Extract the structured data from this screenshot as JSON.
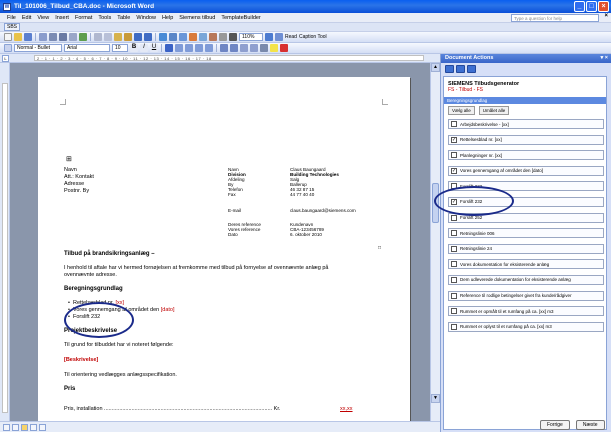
{
  "window": {
    "title": "Til_101006_Tilbud_CBA.doc - Microsoft Word"
  },
  "menu": {
    "items": [
      "File",
      "Edit",
      "View",
      "Insert",
      "Format",
      "Tools",
      "Table",
      "Window",
      "Help",
      "Siemens tilbud",
      "TemplateBuilder"
    ],
    "help_placeholder": "Type a question for help",
    "sbs": "SBS"
  },
  "toolbar": {
    "style": "Normal - Bullet",
    "font": "Arial",
    "size": "10",
    "zoom": "110%",
    "read": "Read",
    "caption": "Caption Tool"
  },
  "ruler": {
    "text": "2 · 1 · 1 · 2 · 3 · 4 · 5 · 6 · 7 · 8 · 9 · 10 · 11 · 12 · 13 · 14 · 15 · 16 · 17 · 18"
  },
  "document": {
    "left_block": [
      "Navn",
      "Att.: Kontakt",
      "Adresse",
      "Postnr. By"
    ],
    "right_labels": [
      "Navn",
      "Division",
      "Afdeling",
      "By",
      "Telefon",
      "Fax",
      "",
      "E-mail",
      "",
      "Deres reference",
      "Vores reference",
      "Dato"
    ],
    "right_values": [
      "Claus Baungaard",
      "Building Technologies",
      "Salg",
      "Ballerup",
      "46 32 87 15",
      "44 77 40 40",
      "",
      "claus.baungaard@siemens.com",
      "",
      "Kundenavn",
      "CBA-123456789",
      "6. oktober 2010"
    ],
    "heading": "Tilbud på brandsikringsanlæg –",
    "intro1": "I henhold til aftale har vi hermed fornøjelsen at fremkomme med tilbud på fornyelse af ovennævnte anlæg på",
    "intro2": "ovennævnte adresse.",
    "beregn": "Beregningsgrundlag",
    "bullet1_pre": "Rettelsesblad nr.",
    "bullet1_red": "[xx]",
    "bullet2_pre": "Vores gennemgang af området den",
    "bullet2_red": "[dato]",
    "bullet3": "Forslift 232",
    "projekt": "Projektbeskrivelse",
    "grund": "Til grund for tilbuddet har vi noteret følgende:",
    "beskrivelse": "[Beskrivelse]",
    "orient": "Til orientering vedlægges anlægsspecifikation.",
    "pris": "Pris",
    "pris_line": "Pris,  installation .............................................................................................................. Kr.",
    "pris_val": "xx,xx"
  },
  "pane": {
    "header": "Document Actions",
    "title": "SIEMENS Tilbudsgenerator",
    "subtitle": "FS - Tilbud - FS",
    "group": "Beregningsgrundlag",
    "select_all": "Vælg alle",
    "deselect_all": "Umålet alle",
    "checkboxes": [
      {
        "label": "Arbejdsbeskrivelse - [xx]",
        "checked": ""
      },
      {
        "label": "Rettelsesblad nr. [xx]",
        "checked": "✓"
      },
      {
        "label": "Planlegninger nr. [xx]",
        "checked": ""
      },
      {
        "label": "Vores gennemgang af området den [dato]",
        "checked": "✓"
      },
      {
        "label": "Forslift 232",
        "checked": ""
      },
      {
        "label": "Forslift 232",
        "checked": "✓"
      },
      {
        "label": "Forslift 252",
        "checked": ""
      },
      {
        "label": "Retningslinie 006",
        "checked": ""
      },
      {
        "label": "Retningslinie 24",
        "checked": ""
      },
      {
        "label": "Vores dokumentation for eksisterende anlæg",
        "checked": ""
      },
      {
        "label": "Dem udleverede dokumentation for eksisterende anlæg",
        "checked": ""
      },
      {
        "label": "Reference til rodlige betingelser givet fra kunde/rådgiver",
        "checked": ""
      },
      {
        "label": "Rummet er opmålt til et rumfang på ca. [xx] m3",
        "checked": ""
      },
      {
        "label": "Rummet er oplyst til et rumfang på ca. [xx] m3",
        "checked": ""
      }
    ],
    "prev": "Forrige",
    "next": "Næste"
  }
}
